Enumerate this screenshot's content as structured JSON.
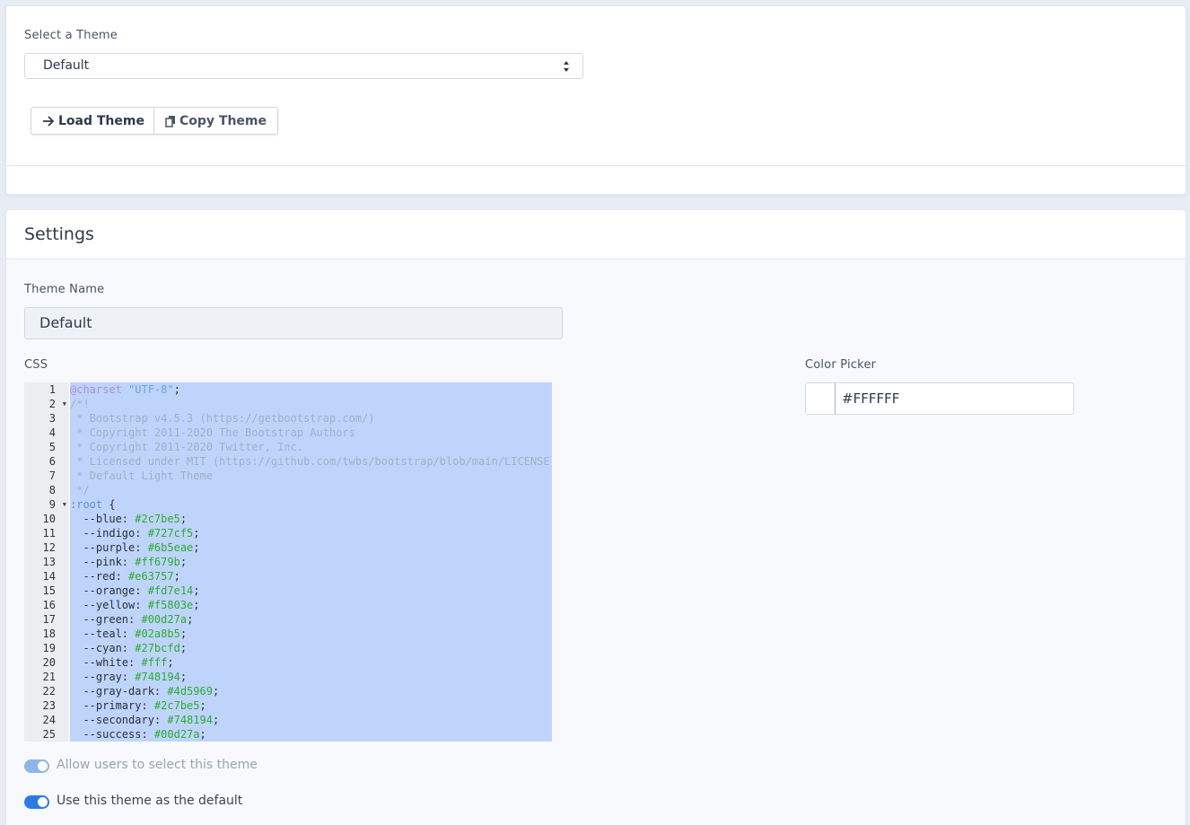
{
  "theme_select": {
    "label": "Select a Theme",
    "selected": "Default"
  },
  "buttons": {
    "load_label": "Load Theme",
    "copy_label": "Copy Theme"
  },
  "settings": {
    "title": "Settings",
    "theme_name_label": "Theme Name",
    "theme_name_value": "Default",
    "css_label": "CSS",
    "color_picker_label": "Color Picker",
    "color_picker_value": "#FFFFFF",
    "toggle_allow_label": "Allow users to select this theme",
    "toggle_default_label": "Use this theme as the default"
  },
  "editor": {
    "lines": [
      [
        [
          "at",
          "@charset "
        ],
        [
          "str",
          "\"UTF-8\""
        ],
        [
          "punc",
          ";"
        ]
      ],
      [
        [
          "cmt",
          "/*!"
        ]
      ],
      [
        [
          "cmt",
          " * Bootstrap v4.5.3 (https://getbootstrap.com/)"
        ]
      ],
      [
        [
          "cmt",
          " * Copyright 2011-2020 The Bootstrap Authors"
        ]
      ],
      [
        [
          "cmt",
          " * Copyright 2011-2020 Twitter, Inc."
        ]
      ],
      [
        [
          "cmt",
          " * Licensed under MIT (https://github.com/twbs/bootstrap/blob/main/LICENSE)"
        ]
      ],
      [
        [
          "cmt",
          " * Default Light Theme"
        ]
      ],
      [
        [
          "cmt",
          " */"
        ]
      ],
      [
        [
          "sel",
          ":root"
        ],
        [
          "punc",
          " {"
        ]
      ],
      [
        [
          "prop",
          "  --blue: "
        ],
        [
          "val",
          "#2c7be5"
        ],
        [
          "punc",
          ";"
        ]
      ],
      [
        [
          "prop",
          "  --indigo: "
        ],
        [
          "val",
          "#727cf5"
        ],
        [
          "punc",
          ";"
        ]
      ],
      [
        [
          "prop",
          "  --purple: "
        ],
        [
          "val",
          "#6b5eae"
        ],
        [
          "punc",
          ";"
        ]
      ],
      [
        [
          "prop",
          "  --pink: "
        ],
        [
          "val",
          "#ff679b"
        ],
        [
          "punc",
          ";"
        ]
      ],
      [
        [
          "prop",
          "  --red: "
        ],
        [
          "val",
          "#e63757"
        ],
        [
          "punc",
          ";"
        ]
      ],
      [
        [
          "prop",
          "  --orange: "
        ],
        [
          "val",
          "#fd7e14"
        ],
        [
          "punc",
          ";"
        ]
      ],
      [
        [
          "prop",
          "  --yellow: "
        ],
        [
          "val",
          "#f5803e"
        ],
        [
          "punc",
          ";"
        ]
      ],
      [
        [
          "prop",
          "  --green: "
        ],
        [
          "val",
          "#00d27a"
        ],
        [
          "punc",
          ";"
        ]
      ],
      [
        [
          "prop",
          "  --teal: "
        ],
        [
          "val",
          "#02a8b5"
        ],
        [
          "punc",
          ";"
        ]
      ],
      [
        [
          "prop",
          "  --cyan: "
        ],
        [
          "val",
          "#27bcfd"
        ],
        [
          "punc",
          ";"
        ]
      ],
      [
        [
          "prop",
          "  --white: "
        ],
        [
          "val",
          "#fff"
        ],
        [
          "punc",
          ";"
        ]
      ],
      [
        [
          "prop",
          "  --gray: "
        ],
        [
          "val",
          "#748194"
        ],
        [
          "punc",
          ";"
        ]
      ],
      [
        [
          "prop",
          "  --gray-dark: "
        ],
        [
          "val",
          "#4d5969"
        ],
        [
          "punc",
          ";"
        ]
      ],
      [
        [
          "prop",
          "  --primary: "
        ],
        [
          "val",
          "#2c7be5"
        ],
        [
          "punc",
          ";"
        ]
      ],
      [
        [
          "prop",
          "  --secondary: "
        ],
        [
          "val",
          "#748194"
        ],
        [
          "punc",
          ";"
        ]
      ],
      [
        [
          "prop",
          "  --success: "
        ],
        [
          "val",
          "#00d27a"
        ],
        [
          "punc",
          ";"
        ]
      ]
    ],
    "fold_lines": [
      2,
      9
    ]
  },
  "colors": {
    "accent": "#2c7be5",
    "selection": "#bfd4fb"
  }
}
